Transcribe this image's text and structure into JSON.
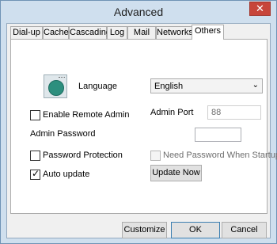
{
  "window": {
    "title": "Advanced",
    "close_glyph": "✕"
  },
  "tabs": [
    {
      "label": "Dial-up"
    },
    {
      "label": "Cache"
    },
    {
      "label": "Cascading"
    },
    {
      "label": "Log"
    },
    {
      "label": "Mail"
    },
    {
      "label": "Networks"
    },
    {
      "label": "Others",
      "active": true
    }
  ],
  "others": {
    "language_icon": "language-globe-icon",
    "language_label": "Language",
    "language_value": "English",
    "dropdown_arrow": "⌄",
    "enable_remote_admin_label": "Enable Remote Admin",
    "enable_remote_admin_checked": false,
    "admin_port_label": "Admin Port",
    "admin_port_value": "88",
    "admin_password_label": "Admin Password",
    "admin_password_value": "",
    "password_protection_label": "Password Protection",
    "password_protection_checked": false,
    "need_password_label": "Need Password When Startup",
    "need_password_checked": false,
    "auto_update_label": "Auto update",
    "auto_update_checked": true,
    "update_now_label": "Update Now",
    "check_glyph": "✓"
  },
  "buttons": {
    "customize": "Customize",
    "ok": "OK",
    "cancel": "Cancel"
  }
}
